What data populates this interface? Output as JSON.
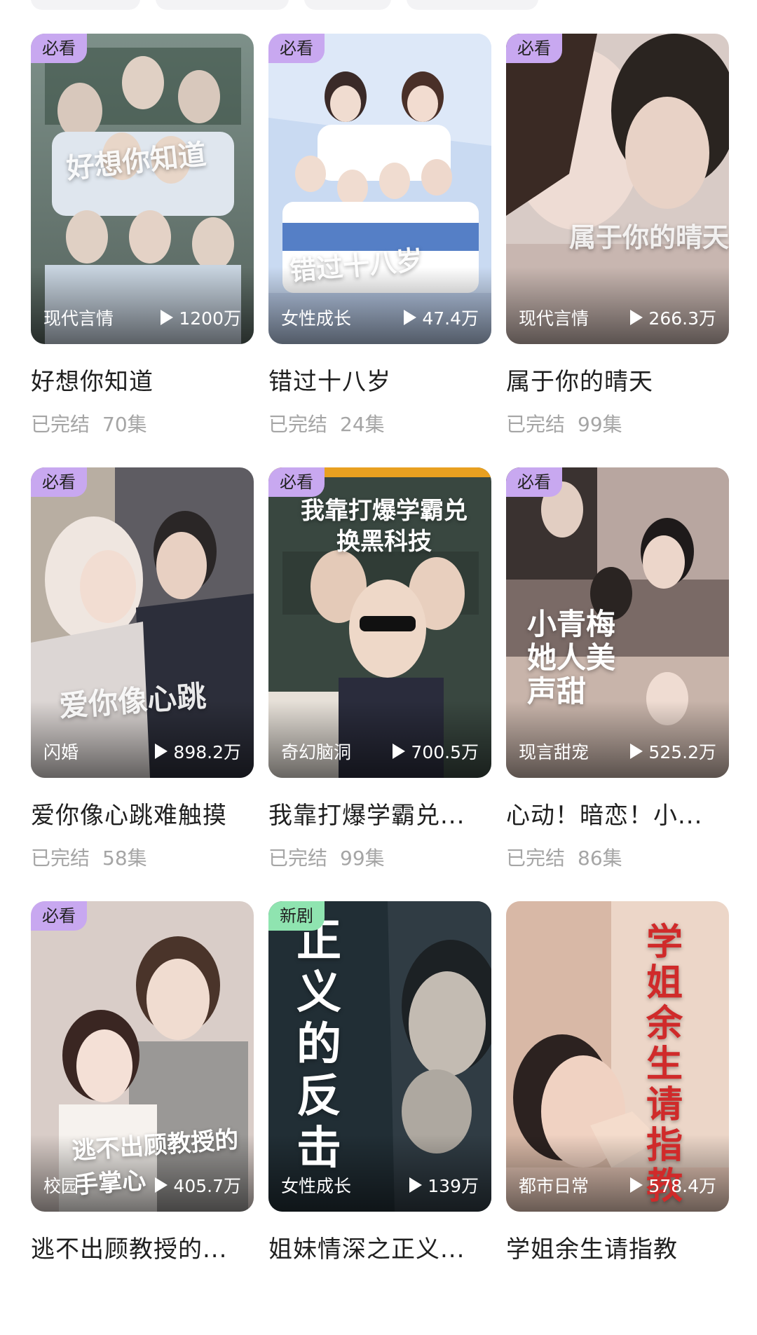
{
  "cards": [
    {
      "badge": "必看",
      "badge_color": "#c8a8f0",
      "genre": "现代言情",
      "views": "1200万",
      "title": "好想你知道",
      "status": "已完结",
      "episodes": "70集",
      "poster_text": "好想你知道",
      "colors": [
        "#6b7f7a",
        "#a9b8b2"
      ]
    },
    {
      "badge": "必看",
      "badge_color": "#c8a8f0",
      "genre": "女性成长",
      "views": "47.4万",
      "title": "错过十八岁",
      "status": "已完结",
      "episodes": "24集",
      "poster_text": "错过十八岁",
      "colors": [
        "#bcd3f0",
        "#e8eef8"
      ]
    },
    {
      "badge": "必看",
      "badge_color": "#c8a8f0",
      "genre": "现代言情",
      "views": "266.3万",
      "title": "属于你的晴天",
      "status": "已完结",
      "episodes": "99集",
      "poster_text": "属于你的晴天",
      "colors": [
        "#b8aaa8",
        "#e8dcd8"
      ]
    },
    {
      "badge": "必看",
      "badge_color": "#c8a8f0",
      "genre": "闪婚",
      "views": "898.2万",
      "title": "爱你像心跳难触摸",
      "status": "已完结",
      "episodes": "58集",
      "poster_text": "爱你像心跳",
      "colors": [
        "#3a3e4a",
        "#8d8a86"
      ]
    },
    {
      "badge": "必看",
      "badge_color": "#c8a8f0",
      "genre": "奇幻脑洞",
      "views": "700.5万",
      "title": "我靠打爆学霸兑...",
      "status": "已完结",
      "episodes": "99集",
      "poster_text": "我靠打爆学霸兑换黑科技",
      "colors": [
        "#3c4a40",
        "#b8b0a0"
      ]
    },
    {
      "badge": "必看",
      "badge_color": "#c8a8f0",
      "genre": "现言甜宠",
      "views": "525.2万",
      "title": "心动！暗恋！小...",
      "status": "已完结",
      "episodes": "86集",
      "poster_text": "小青梅她人美声甜",
      "colors": [
        "#4a3c3a",
        "#c9b2a8"
      ]
    },
    {
      "badge": "必看",
      "badge_color": "#c8a8f0",
      "genre": "校园",
      "views": "405.7万",
      "title": "逃不出顾教授的...",
      "status": "",
      "episodes": "",
      "poster_text": "逃不出顾教授的手掌心",
      "colors": [
        "#c9b9b6",
        "#efe7e0"
      ]
    },
    {
      "badge": "新剧",
      "badge_color": "#8fe4b0",
      "genre": "女性成长",
      "views": "139万",
      "title": "姐妹情深之正义...",
      "status": "",
      "episodes": "",
      "poster_text": "正义的反击",
      "colors": [
        "#1c242c",
        "#4c5660"
      ]
    },
    {
      "badge": "",
      "badge_color": "",
      "genre": "都市日常",
      "views": "578.4万",
      "title": "学姐余生请指教",
      "status": "",
      "episodes": "",
      "poster_text": "学姐余生请指教",
      "colors": [
        "#e4c8b8",
        "#f6e8dc"
      ]
    }
  ]
}
